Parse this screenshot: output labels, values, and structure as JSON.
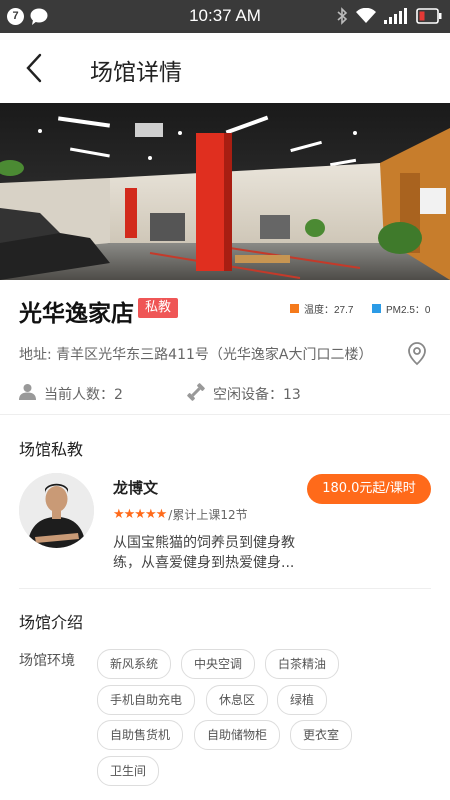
{
  "status_bar": {
    "badge": "7",
    "time": "10:37 AM"
  },
  "header": {
    "title": "场馆详情"
  },
  "venue": {
    "name": "光华逸家店",
    "tag": "私教",
    "temperature": "温度：27.7",
    "pm25": "PM2.5：0",
    "address": "地址: 青羊区光华东三路411号（光华逸家A大门口二楼）",
    "people": "当前人数：2",
    "equipment": "空闲设备：13",
    "colors": {
      "temperature": "#f57a1c",
      "pm25": "#2b9be6",
      "tag": "#ef5656",
      "accent": "#ff6a1a"
    }
  },
  "coach_section": {
    "title": "场馆私教",
    "coach": {
      "name": "龙博文",
      "price": "180.0元起/课时",
      "rating": 5,
      "stars": "★★★★★",
      "lessons": "/累计上课12节",
      "desc_line1": "从国宝熊猫的饲养员到健身教",
      "desc_line2": "练，从喜爱健身到热爱健身..."
    }
  },
  "intro_section": {
    "title": "场馆介绍",
    "env_label": "场馆环境",
    "tags": [
      "新风系统",
      "中央空调",
      "白茶精油",
      "手机自助充电",
      "休息区",
      "绿植",
      "自助售货机",
      "自助储物柜",
      "更衣室",
      "卫生间"
    ]
  }
}
